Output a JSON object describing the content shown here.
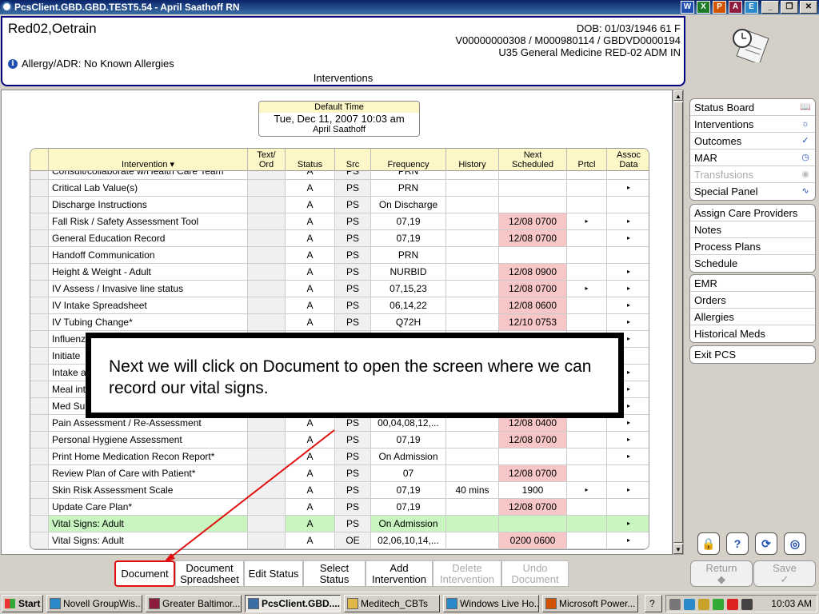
{
  "window": {
    "title": "PcsClient.GBD.GBD.TEST5.54 - April Saathoff RN",
    "controls": [
      "_",
      "❐",
      "✕"
    ],
    "office_icons": [
      "W",
      "X",
      "P",
      "A",
      "E"
    ]
  },
  "patient": {
    "name": "Red02,Oetrain",
    "dob": "DOB: 01/03/1946 61 F",
    "ids": "V00000000308 / M000980114 / GBDVD0000194",
    "location": "U35 General Medicine  RED-02  ADM IN",
    "allergy": "Allergy/ADR: No Known Allergies"
  },
  "screen_title": "Interventions",
  "default_time": {
    "label": "Default Time",
    "value": "Tue, Dec 11, 2007  10:03 am",
    "user": "April Saathoff"
  },
  "table": {
    "headers": {
      "intervention": "Intervention ▾",
      "text_ord": [
        "Text/",
        "Ord"
      ],
      "status": "Status",
      "src": "Src",
      "frequency": "Frequency",
      "history": "History",
      "next": [
        "Next",
        "Scheduled"
      ],
      "prtcl": "Prtcl",
      "assoc": [
        "Assoc",
        "Data"
      ]
    },
    "rows": [
      {
        "name": "Consult/collaborate w/Health Care Team*",
        "status": "A",
        "src": "PS",
        "freq": "PRN",
        "hist": "",
        "next": "",
        "due": false,
        "prtcl": "",
        "assoc": "",
        "partial": true
      },
      {
        "name": "Critical Lab Value(s)",
        "status": "A",
        "src": "PS",
        "freq": "PRN",
        "hist": "",
        "next": "",
        "due": false,
        "prtcl": "",
        "assoc": "▸"
      },
      {
        "name": "Discharge Instructions",
        "status": "A",
        "src": "PS",
        "freq": "On Discharge",
        "hist": "",
        "next": "",
        "due": false,
        "prtcl": "",
        "assoc": ""
      },
      {
        "name": "Fall Risk / Safety Assessment Tool",
        "status": "A",
        "src": "PS",
        "freq": "07,19",
        "hist": "",
        "next": "12/08 0700",
        "due": true,
        "prtcl": "▸",
        "assoc": "▸"
      },
      {
        "name": "General Education Record",
        "status": "A",
        "src": "PS",
        "freq": "07,19",
        "hist": "",
        "next": "12/08 0700",
        "due": true,
        "prtcl": "",
        "assoc": "▸"
      },
      {
        "name": "Handoff Communication",
        "status": "A",
        "src": "PS",
        "freq": "PRN",
        "hist": "",
        "next": "",
        "due": false,
        "prtcl": "",
        "assoc": ""
      },
      {
        "name": "Height & Weight - Adult",
        "status": "A",
        "src": "PS",
        "freq": "NURBID",
        "hist": "",
        "next": "12/08 0900",
        "due": true,
        "prtcl": "",
        "assoc": "▸"
      },
      {
        "name": "IV Assess / Invasive line status",
        "status": "A",
        "src": "PS",
        "freq": "07,15,23",
        "hist": "",
        "next": "12/08 0700",
        "due": true,
        "prtcl": "▸",
        "assoc": "▸"
      },
      {
        "name": "IV Intake Spreadsheet",
        "status": "A",
        "src": "PS",
        "freq": "06,14,22",
        "hist": "",
        "next": "12/08 0600",
        "due": true,
        "prtcl": "",
        "assoc": "▸"
      },
      {
        "name": "IV Tubing Change*",
        "status": "A",
        "src": "PS",
        "freq": "Q72H",
        "hist": "",
        "next": "12/10 0753",
        "due": true,
        "prtcl": "",
        "assoc": "▸"
      },
      {
        "name": "Influenz",
        "status": "",
        "src": "",
        "freq": "",
        "hist": "",
        "next": "",
        "due": false,
        "prtcl": "",
        "assoc": "▸"
      },
      {
        "name": "Initiate",
        "status": "",
        "src": "",
        "freq": "",
        "hist": "",
        "next": "",
        "due": false,
        "prtcl": "",
        "assoc": ""
      },
      {
        "name": "Intake a",
        "status": "",
        "src": "",
        "freq": "",
        "hist": "",
        "next": "",
        "due": false,
        "prtcl": "",
        "assoc": "▸"
      },
      {
        "name": "Meal int",
        "status": "",
        "src": "",
        "freq": "",
        "hist": "",
        "next": "",
        "due": false,
        "prtcl": "",
        "assoc": "▸"
      },
      {
        "name": "Med Sur",
        "status": "",
        "src": "",
        "freq": "",
        "hist": "",
        "next": "",
        "due": false,
        "prtcl": "",
        "assoc": "▸"
      },
      {
        "name": "Pain Assessment / Re-Assessment",
        "status": "A",
        "src": "PS",
        "freq": "00,04,08,12,...",
        "hist": "",
        "next": "12/08 0400",
        "due": true,
        "prtcl": "",
        "assoc": "▸"
      },
      {
        "name": "Personal Hygiene Assessment",
        "status": "A",
        "src": "PS",
        "freq": "07,19",
        "hist": "",
        "next": "12/08 0700",
        "due": true,
        "prtcl": "",
        "assoc": "▸"
      },
      {
        "name": "Print Home Medication Recon Report*",
        "status": "A",
        "src": "PS",
        "freq": "On Admission",
        "hist": "",
        "next": "",
        "due": false,
        "prtcl": "",
        "assoc": "▸"
      },
      {
        "name": "Review Plan of Care with Patient*",
        "status": "A",
        "src": "PS",
        "freq": "07",
        "hist": "",
        "next": "12/08 0700",
        "due": true,
        "prtcl": "",
        "assoc": ""
      },
      {
        "name": "Skin Risk Assessment Scale",
        "status": "A",
        "src": "PS",
        "freq": "07,19",
        "hist": "40 mins",
        "next": "1900",
        "due": false,
        "prtcl": "▸",
        "assoc": "▸"
      },
      {
        "name": "Update Care Plan*",
        "status": "A",
        "src": "PS",
        "freq": "07,19",
        "hist": "",
        "next": "12/08 0700",
        "due": true,
        "prtcl": "",
        "assoc": ""
      },
      {
        "name": "Vital Signs: Adult",
        "status": "A",
        "src": "PS",
        "freq": "On Admission",
        "hist": "",
        "next": "",
        "due": false,
        "prtcl": "",
        "assoc": "▸",
        "highlight": true
      },
      {
        "name": "Vital Signs: Adult",
        "status": "A",
        "src": "OE",
        "freq": "02,06,10,14,...",
        "hist": "",
        "next": "0200 0600",
        "due": true,
        "prtcl": "",
        "assoc": "▸"
      }
    ]
  },
  "nav": {
    "group1": [
      {
        "label": "Status Board",
        "icon": "book-icon",
        "glyph": "📖",
        "disabled": false
      },
      {
        "label": "Interventions",
        "icon": "stethoscope-icon",
        "glyph": "☼",
        "disabled": false
      },
      {
        "label": "Outcomes",
        "icon": "checklist-icon",
        "glyph": "✓",
        "disabled": false
      },
      {
        "label": "MAR",
        "icon": "clock-icon",
        "glyph": "◷",
        "disabled": false
      },
      {
        "label": "Transfusions",
        "icon": "drop-icon",
        "glyph": "◉",
        "disabled": true
      },
      {
        "label": "Special Panel",
        "icon": "pulse-icon",
        "glyph": "∿",
        "disabled": false
      }
    ],
    "group2": [
      "Assign Care Providers",
      "Notes",
      "Process Plans",
      "Schedule"
    ],
    "group3": [
      "EMR",
      "Orders",
      "Allergies",
      "Historical Meds"
    ],
    "group4": [
      "Exit PCS"
    ]
  },
  "tools": [
    {
      "name": "lock-icon",
      "glyph": "🔒"
    },
    {
      "name": "help-icon",
      "glyph": "?"
    },
    {
      "name": "refresh-icon",
      "glyph": "⟳"
    },
    {
      "name": "settings-icon",
      "glyph": "◎"
    }
  ],
  "return_save": {
    "return": "Return",
    "return_glyph": "◆",
    "save": "Save",
    "save_glyph": "✓"
  },
  "actions": [
    {
      "label": "Document",
      "disabled": false
    },
    {
      "label": "Document Spreadsheet",
      "disabled": false
    },
    {
      "label": "Edit Status",
      "disabled": false
    },
    {
      "label": "Select Status",
      "disabled": false
    },
    {
      "label": "Add Intervention",
      "disabled": false
    },
    {
      "label": "Delete Intervention",
      "disabled": true
    },
    {
      "label": "Undo Document",
      "disabled": true
    }
  ],
  "callout": {
    "text": "Next we will click on Document to open the screen where we can record our vital signs."
  },
  "taskbar": {
    "start": "Start",
    "tasks": [
      "Novell GroupWis...",
      "Greater Baltimor...",
      "PcsClient.GBD....",
      "Meditech_CBTs",
      "Windows Live Ho...",
      "Microsoft Power..."
    ],
    "active_task": 2,
    "time": "10:03 AM"
  }
}
